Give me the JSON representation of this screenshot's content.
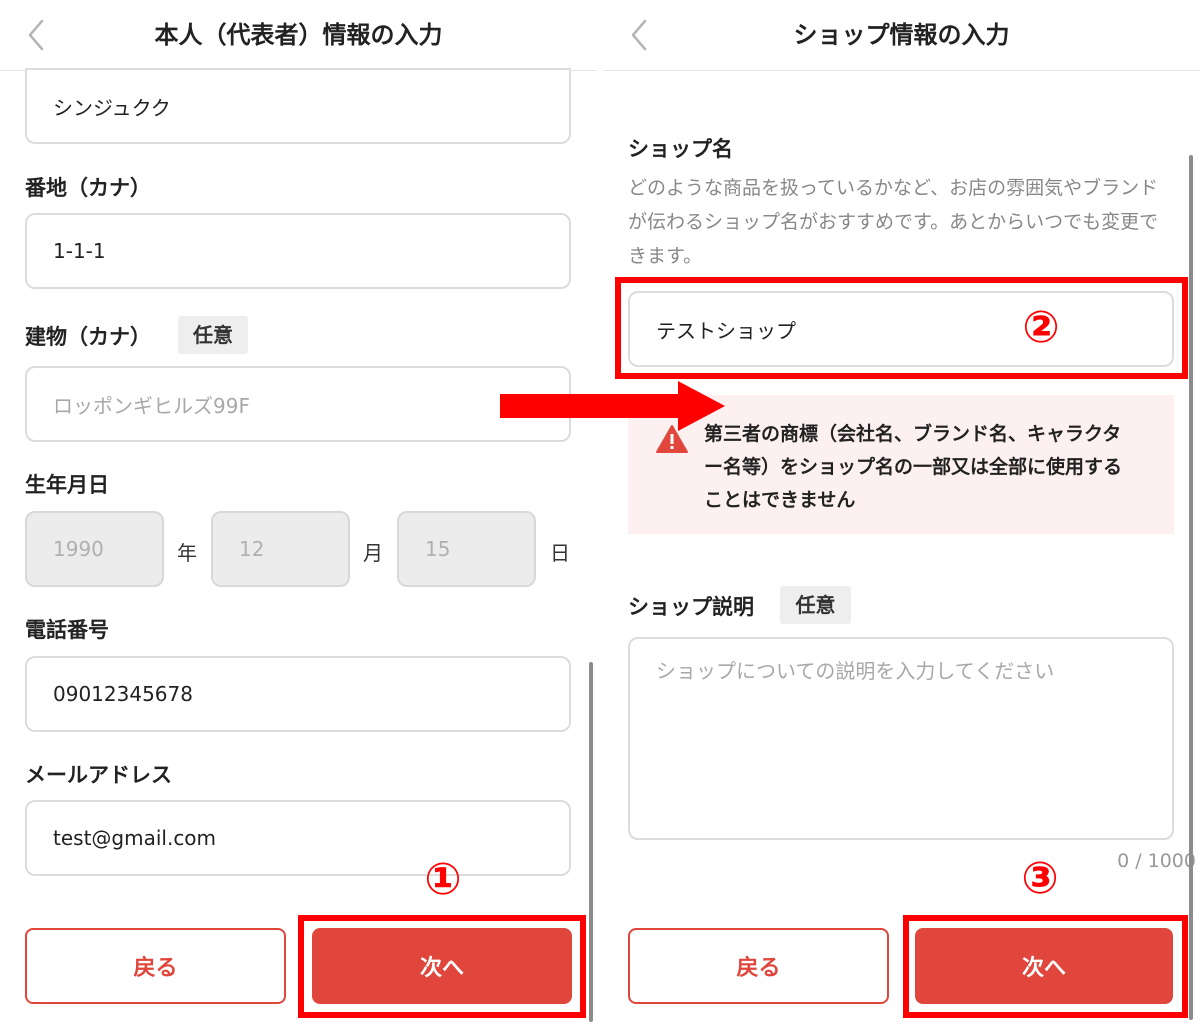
{
  "left": {
    "header": {
      "title": "本人（代表者）情報の入力"
    },
    "town_kana": {
      "value": "シンジュクク"
    },
    "address_kana": {
      "label": "番地（カナ）",
      "value": "1-1-1"
    },
    "building_kana": {
      "label": "建物（カナ）",
      "optional": "任意",
      "placeholder": "ロッポンギヒルズ99F"
    },
    "birthday": {
      "label": "生年月日",
      "year": "1990",
      "year_unit": "年",
      "month": "12",
      "month_unit": "月",
      "day": "15",
      "day_unit": "日"
    },
    "phone": {
      "label": "電話番号",
      "value": "09012345678"
    },
    "email": {
      "label": "メールアドレス",
      "value": "test@gmail.com"
    },
    "back_button": "戻る",
    "next_button": "次へ",
    "step_marker": "①"
  },
  "right": {
    "header": {
      "title": "ショップ情報の入力"
    },
    "shop_name": {
      "label": "ショップ名",
      "help": "どのような商品を扱っているかなど、お店の雰囲気やブランドが伝わるショップ名がおすすめです。あとからいつでも変更できます。",
      "value": "テストショップ"
    },
    "warning": "第三者の商標（会社名、ブランド名、キャラクター名等）をショップ名の一部又は全部に使用することはできません",
    "shop_description": {
      "label": "ショップ説明",
      "optional": "任意",
      "placeholder": "ショップについての説明を入力してください",
      "counter": "0 / 1000"
    },
    "back_button": "戻る",
    "next_button": "次へ",
    "step_marker_2": "②",
    "step_marker_3": "③"
  },
  "colors": {
    "accent": "#e0463c",
    "annotation": "#ff0000",
    "warning_bg": "#fdf0f0"
  },
  "icons": {
    "back": "chevron-left-icon",
    "warning": "warning-triangle-icon",
    "arrow": "arrow-right-icon"
  }
}
